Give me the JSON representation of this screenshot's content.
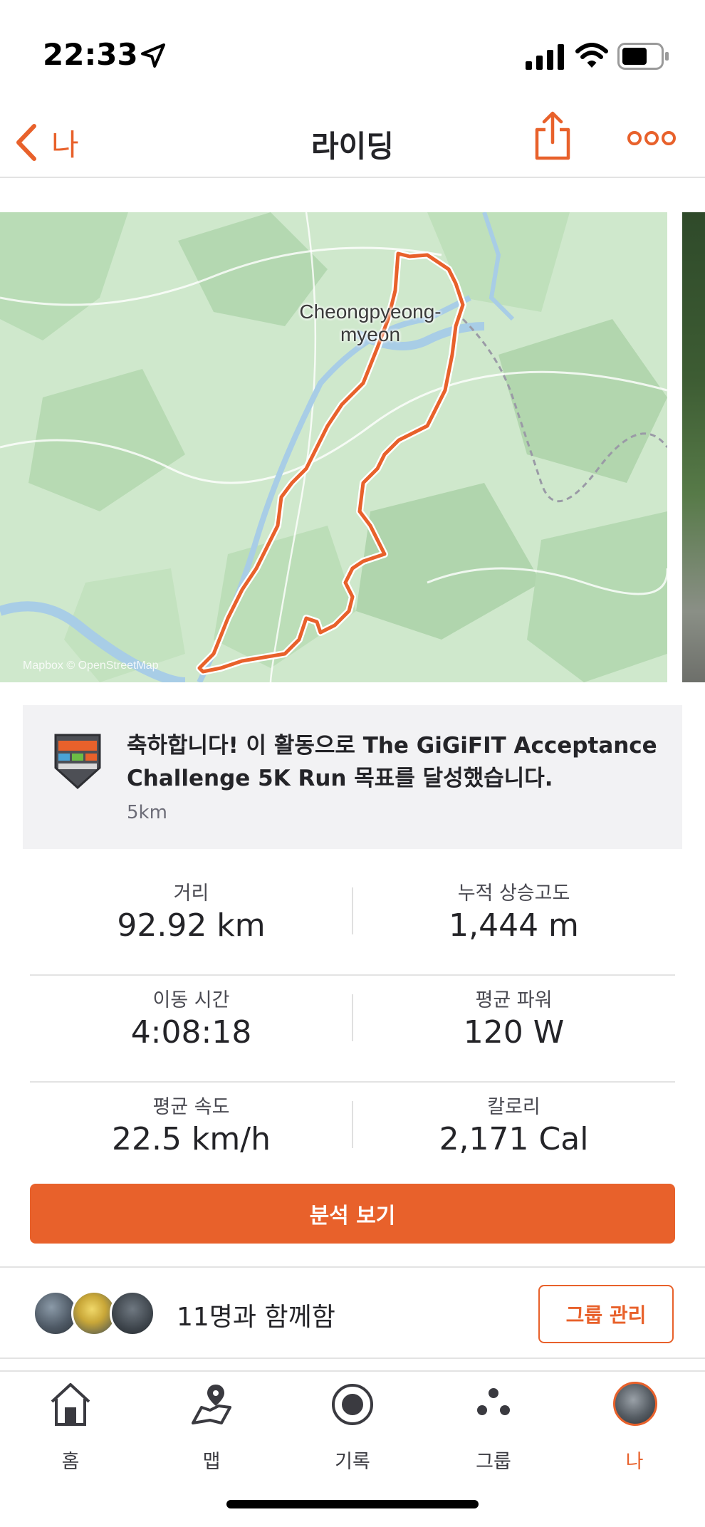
{
  "status_bar": {
    "time": "22:33"
  },
  "nav": {
    "back_label": "나",
    "title": "라이딩"
  },
  "map": {
    "place_label_line1": "Cheongpyeong-",
    "place_label_line2": "myeon",
    "attribution": "Mapbox © OpenStreetMap",
    "route_color": "#e8612b"
  },
  "achievement": {
    "message": "축하합니다! 이 활동으로 The GiGiFIT Acceptance Challenge 5K Run 목표를 달성했습니다.",
    "subtitle": "5km"
  },
  "stats": [
    {
      "left": {
        "label": "거리",
        "value": "92.92 km"
      },
      "right": {
        "label": "누적 상승고도",
        "value": "1,444 m"
      }
    },
    {
      "left": {
        "label": "이동 시간",
        "value": "4:08:18"
      },
      "right": {
        "label": "평균 파워",
        "value": "120 W"
      }
    },
    {
      "left": {
        "label": "평균 속도",
        "value": "22.5 km/h"
      },
      "right": {
        "label": "칼로리",
        "value": "2,171 Cal"
      }
    }
  ],
  "analysis_button": "분석 보기",
  "group": {
    "text": "11명과 함께함",
    "manage_button": "그룹 관리"
  },
  "tabs": [
    {
      "label": "홈",
      "icon": "home-icon"
    },
    {
      "label": "맵",
      "icon": "map-icon"
    },
    {
      "label": "기록",
      "icon": "record-icon"
    },
    {
      "label": "그룹",
      "icon": "groups-icon"
    },
    {
      "label": "나",
      "icon": "profile-avatar",
      "active": true
    }
  ],
  "colors": {
    "accent": "#e8612b",
    "text": "#242428",
    "muted": "#6d6d78"
  }
}
